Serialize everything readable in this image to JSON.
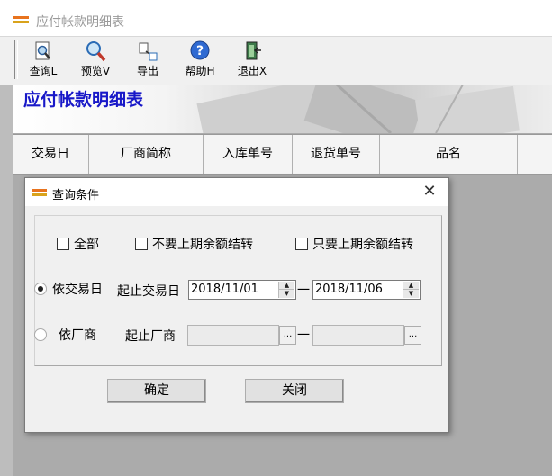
{
  "window": {
    "title": "应付帐款明细表"
  },
  "toolbar": {
    "items": [
      {
        "label": "查询L",
        "icon": "query-icon"
      },
      {
        "label": "预览V",
        "icon": "preview-icon"
      },
      {
        "label": "导出",
        "icon": "export-icon"
      },
      {
        "label": "帮助H",
        "icon": "help-icon"
      },
      {
        "label": "退出X",
        "icon": "exit-icon"
      }
    ]
  },
  "banner": {
    "title": "应付帐款明细表"
  },
  "grid": {
    "columns": [
      "交易日",
      "厂商简称",
      "入库单号",
      "退货单号",
      "品名"
    ]
  },
  "dialog": {
    "title": "查询条件",
    "close_symbol": "✕",
    "checkbox_all": "全部",
    "checkbox_no_prev": "不要上期余额结转",
    "checkbox_only_prev": "只要上期余额结转",
    "radio_by_date": "依交易日",
    "radio_by_vendor": "依厂商",
    "date_range_label": "起止交易日",
    "date_from": "2018/11/01",
    "date_to": "2018/11/06",
    "range_sep": "一",
    "vendor_range_label": "起止厂商",
    "vendor_from": "",
    "vendor_to": "",
    "ellipsis": "...",
    "ok_button": "确定",
    "close_button": "关闭"
  },
  "colors": {
    "banner_title": "#1818c8",
    "background": "#ababab"
  }
}
